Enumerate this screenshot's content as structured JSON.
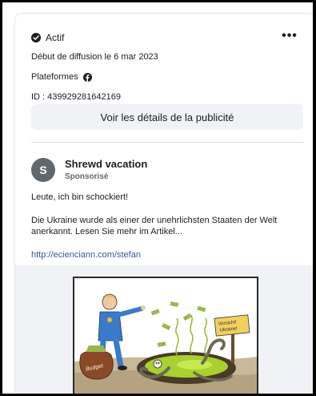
{
  "ad": {
    "status": "Actif",
    "more_label": "•••",
    "start_date": "Début de diffusion le 6 mar 2023",
    "platforms_label": "Plateformes",
    "id_line": "ID : 439929281642169",
    "details_button": "Voir les détails de la publicité"
  },
  "post": {
    "avatar_letter": "S",
    "page_name": "Shrewd vacation",
    "sponsored": "Sponsorisé",
    "text_1": "Leute, ich bin schockiert!",
    "text_2": "Die Ukraine wurde als einer der unehrlichsten Staaten der Welt anerkannt. Lesen Sie mehr im Artikel...",
    "link": "http://ecienciann.com/stefan"
  },
  "cartoon": {
    "sign_text_1": "Vorsicht!",
    "sign_text_2": "Ukraine!",
    "bag_text": "Budget"
  },
  "colors": {
    "link": "#385898",
    "button_bg": "#f0f2f5",
    "text": "#1c1e21",
    "muted": "#65676b"
  },
  "icons": {
    "status": "check-circle-icon",
    "platform": "facebook-icon",
    "more": "more-dots-icon"
  }
}
